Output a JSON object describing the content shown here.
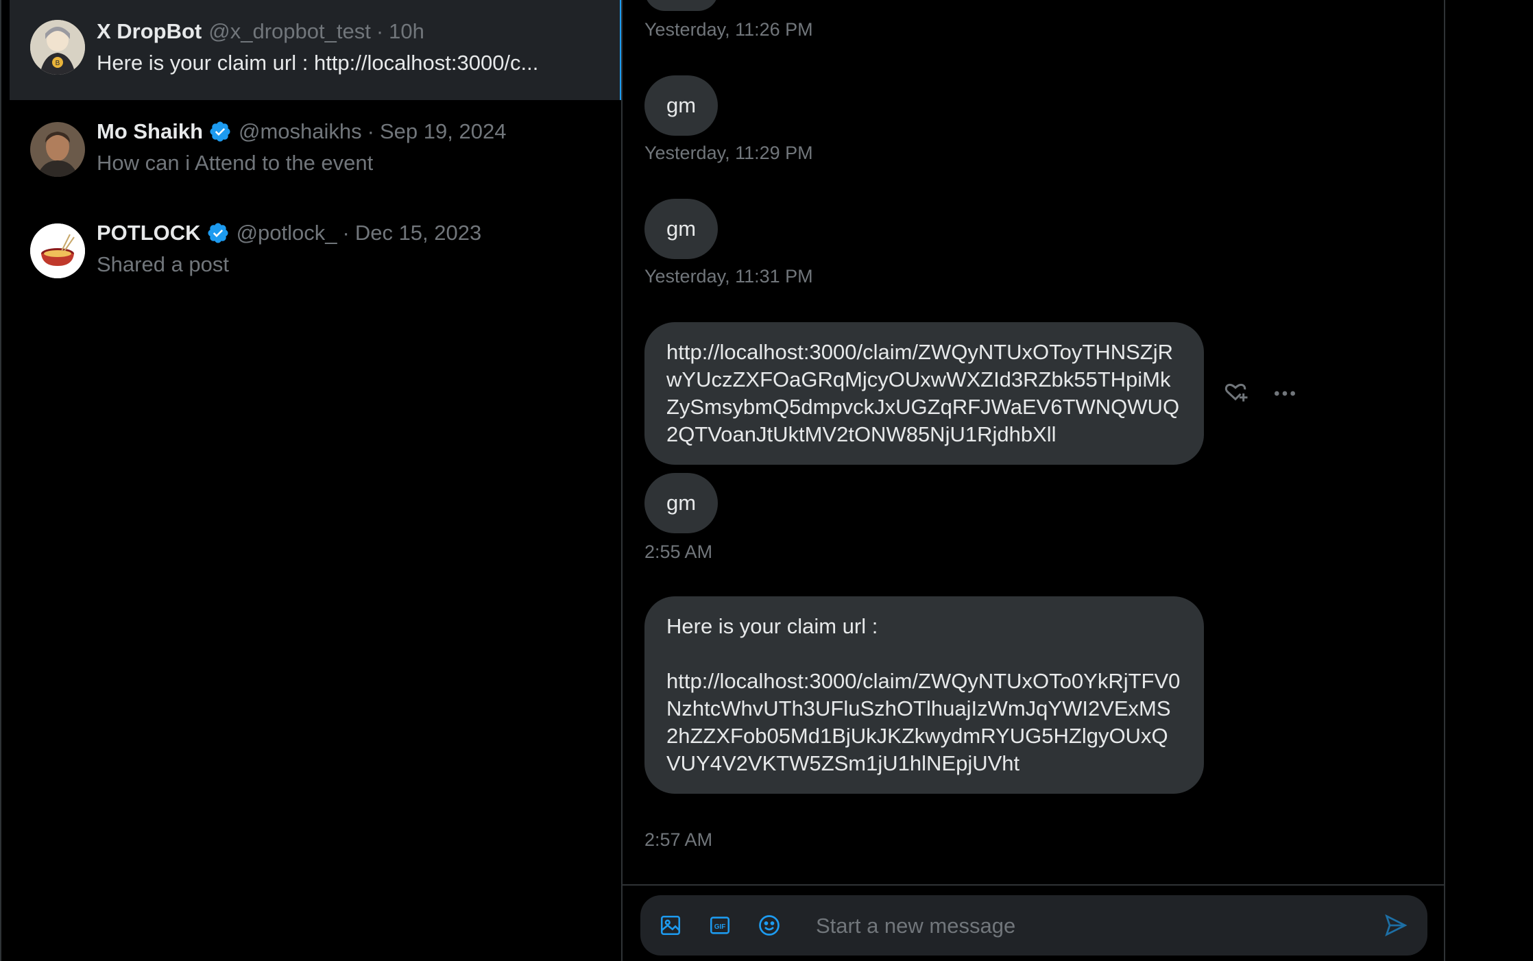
{
  "conversations": [
    {
      "name": "X DropBot",
      "handle": "@x_dropbot_test",
      "separator": "·",
      "time": "10h",
      "preview": "Here is your claim url : http://localhost:3000/c...",
      "verified": false,
      "active": true
    },
    {
      "name": "Mo Shaikh",
      "handle": "@moshaikhs",
      "separator": "·",
      "time": "Sep 19, 2024",
      "preview": "How can i Attend to the event",
      "verified": true,
      "active": false
    },
    {
      "name": "POTLOCK",
      "handle": "@potlock_",
      "separator": "·",
      "time": "Dec 15, 2023",
      "preview": "Shared a post",
      "verified": true,
      "active": false
    }
  ],
  "messages": [
    {
      "type": "time",
      "text": "Yesterday, 11:26 PM"
    },
    {
      "type": "bubble",
      "text": "gm"
    },
    {
      "type": "time",
      "text": "Yesterday, 11:29 PM"
    },
    {
      "type": "bubble",
      "text": "gm"
    },
    {
      "type": "time",
      "text": "Yesterday, 11:31 PM"
    },
    {
      "type": "bubble",
      "text": "http://localhost:3000/claim/ZWQyNTUxOToyTHNSZjRwYUczZXFOaGRqMjcyOUxwWXZId3RZbk55THpiMkZySmsybmQ5dmpvckJxUGZqRFJWaEV6TWNQWUQ2QTVoanJtUktMV2tONW85NjU1RjdhbXll"
    },
    {
      "type": "bubble",
      "text": "gm"
    },
    {
      "type": "time",
      "text": "2:55 AM"
    },
    {
      "type": "bubble",
      "text": "Here is your claim url :\n\nhttp://localhost:3000/claim/ZWQyNTUxOTo0YkRjTFV0NzhtcWhvUTh3UFluSzhOTlhuajIzWmJqYWI2VExMS2hZZXFob05Md1BjUkJKZkwydmRYUG5HZlgyOUxQVUY4V2VKTW5ZSm1jU1hlNEpjUVht"
    },
    {
      "type": "time",
      "text": "2:57 AM"
    }
  ],
  "composer": {
    "placeholder": "Start a new message"
  },
  "colors": {
    "background": "#000000",
    "bubble": "#2f3336",
    "accent": "#1d9bf0",
    "muted": "#71767b",
    "text": "#e7e9ea"
  },
  "icons": {
    "react": "heart-plus-icon",
    "more": "more-horizontal-icon",
    "media": "image-icon",
    "gif": "gif-icon",
    "emoji": "emoji-icon",
    "send": "send-icon",
    "verified": "verified-badge-icon"
  }
}
